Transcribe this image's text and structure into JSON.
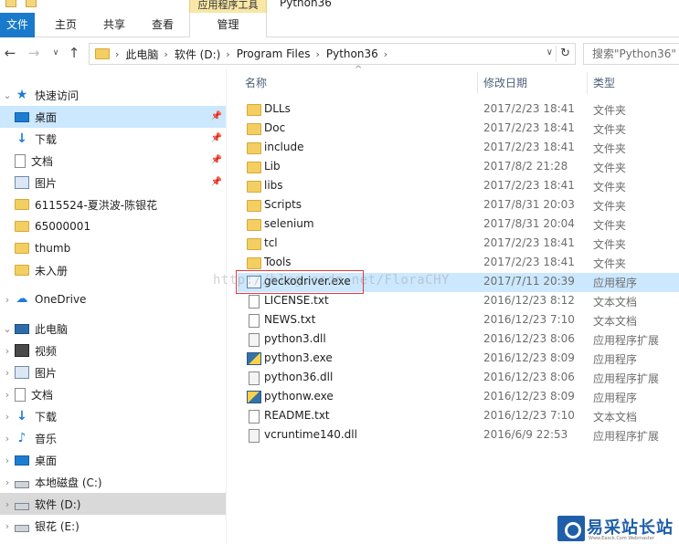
{
  "ribbon": {
    "tabs": [
      "文件",
      "主页",
      "共享",
      "查看"
    ],
    "context_group": "应用程序工具",
    "context_tab": "管理",
    "window_title": "Python36"
  },
  "nav": {
    "breadcrumbs": [
      "此电脑",
      "软件 (D:)",
      "Program Files",
      "Python36"
    ],
    "search_placeholder": "搜索\"Python36\""
  },
  "navpane": {
    "quick_access": "快速访问",
    "quick_items": [
      "桌面",
      "下载",
      "文档",
      "图片",
      "6115524-夏洪波-陈银花",
      "65000001",
      "thumb",
      "未入册"
    ],
    "onedrive": "OneDrive",
    "this_pc": "此电脑",
    "pc_items": [
      "视频",
      "图片",
      "文档",
      "下载",
      "音乐",
      "桌面",
      "本地磁盘 (C:)",
      "软件 (D:)",
      "银花 (E:)"
    ]
  },
  "columns": {
    "name": "名称",
    "date": "修改日期",
    "type": "类型"
  },
  "files": [
    {
      "name": "DLLs",
      "date": "2017/2/23 18:41",
      "type": "文件夹",
      "icon": "folder-icon"
    },
    {
      "name": "Doc",
      "date": "2017/2/23 18:41",
      "type": "文件夹",
      "icon": "folder-icon"
    },
    {
      "name": "include",
      "date": "2017/2/23 18:41",
      "type": "文件夹",
      "icon": "folder-icon"
    },
    {
      "name": "Lib",
      "date": "2017/8/2 21:28",
      "type": "文件夹",
      "icon": "folder-icon"
    },
    {
      "name": "libs",
      "date": "2017/2/23 18:41",
      "type": "文件夹",
      "icon": "folder-icon"
    },
    {
      "name": "Scripts",
      "date": "2017/8/31 20:03",
      "type": "文件夹",
      "icon": "folder-icon"
    },
    {
      "name": "selenium",
      "date": "2017/8/31 20:04",
      "type": "文件夹",
      "icon": "folder-icon"
    },
    {
      "name": "tcl",
      "date": "2017/2/23 18:41",
      "type": "文件夹",
      "icon": "folder-icon"
    },
    {
      "name": "Tools",
      "date": "2017/2/23 18:41",
      "type": "文件夹",
      "icon": "folder-icon"
    },
    {
      "name": "geckodriver.exe",
      "date": "2017/7/11 20:39",
      "type": "应用程序",
      "icon": "exe-icon"
    },
    {
      "name": "LICENSE.txt",
      "date": "2016/12/23 8:12",
      "type": "文本文档",
      "icon": "text-file-icon"
    },
    {
      "name": "NEWS.txt",
      "date": "2016/12/23 7:10",
      "type": "文本文档",
      "icon": "text-file-icon"
    },
    {
      "name": "python3.dll",
      "date": "2016/12/23 8:06",
      "type": "应用程序扩展",
      "icon": "dll-icon"
    },
    {
      "name": "python3.exe",
      "date": "2016/12/23 8:09",
      "type": "应用程序",
      "icon": "python-icon"
    },
    {
      "name": "python36.dll",
      "date": "2016/12/23 8:06",
      "type": "应用程序扩展",
      "icon": "dll-icon"
    },
    {
      "name": "pythonw.exe",
      "date": "2016/12/23 8:09",
      "type": "应用程序",
      "icon": "pythonw-icon"
    },
    {
      "name": "README.txt",
      "date": "2016/12/23 7:10",
      "type": "文本文档",
      "icon": "text-file-icon"
    },
    {
      "name": "vcruntime140.dll",
      "date": "2016/6/9 22:53",
      "type": "应用程序扩展",
      "icon": "dll-icon"
    }
  ],
  "watermark": "http://blog.csdn.net/FloraCHY",
  "logo": {
    "text": "易采站长站",
    "sub": "Www.Easck.Com  Webmaster"
  },
  "colors": {
    "accent": "#1979ca",
    "selection": "#cce8ff",
    "highlight_box": "#e03b3b"
  }
}
